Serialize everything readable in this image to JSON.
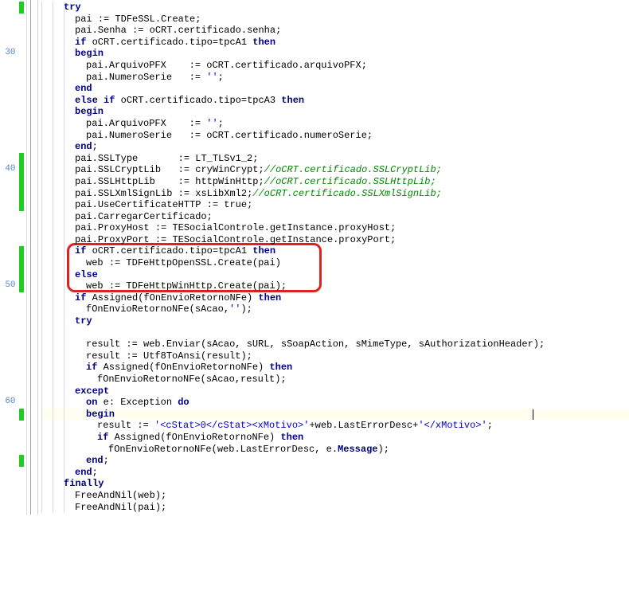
{
  "line_numbers": {
    "30": 4,
    "40": 14,
    "50": 24,
    "60": 34
  },
  "code_lines": [
    {
      "indent": 2,
      "tokens": [
        {
          "t": "kw",
          "v": "try"
        }
      ]
    },
    {
      "indent": 3,
      "tokens": [
        {
          "t": "ident",
          "v": "pai "
        },
        {
          "t": "sym",
          "v": ":= "
        },
        {
          "t": "ident",
          "v": "TDFeSSL"
        },
        {
          "t": "sym",
          "v": "."
        },
        {
          "t": "ident",
          "v": "Create"
        },
        {
          "t": "sym",
          "v": ";"
        }
      ]
    },
    {
      "indent": 3,
      "tokens": [
        {
          "t": "ident",
          "v": "pai"
        },
        {
          "t": "sym",
          "v": "."
        },
        {
          "t": "ident",
          "v": "Senha "
        },
        {
          "t": "sym",
          "v": ":= "
        },
        {
          "t": "ident",
          "v": "oCRT"
        },
        {
          "t": "sym",
          "v": "."
        },
        {
          "t": "ident",
          "v": "certificado"
        },
        {
          "t": "sym",
          "v": "."
        },
        {
          "t": "ident",
          "v": "senha"
        },
        {
          "t": "sym",
          "v": ";"
        }
      ]
    },
    {
      "indent": 3,
      "tokens": [
        {
          "t": "kw",
          "v": "if"
        },
        {
          "t": "ident",
          "v": " oCRT"
        },
        {
          "t": "sym",
          "v": "."
        },
        {
          "t": "ident",
          "v": "certificado"
        },
        {
          "t": "sym",
          "v": "."
        },
        {
          "t": "ident",
          "v": "tipo"
        },
        {
          "t": "sym",
          "v": "="
        },
        {
          "t": "ident",
          "v": "tpcA1 "
        },
        {
          "t": "kw",
          "v": "then"
        }
      ]
    },
    {
      "indent": 3,
      "tokens": [
        {
          "t": "kw",
          "v": "begin"
        }
      ]
    },
    {
      "indent": 4,
      "tokens": [
        {
          "t": "ident",
          "v": "pai"
        },
        {
          "t": "sym",
          "v": "."
        },
        {
          "t": "ident",
          "v": "ArquivoPFX    "
        },
        {
          "t": "sym",
          "v": ":= "
        },
        {
          "t": "ident",
          "v": "oCRT"
        },
        {
          "t": "sym",
          "v": "."
        },
        {
          "t": "ident",
          "v": "certificado"
        },
        {
          "t": "sym",
          "v": "."
        },
        {
          "t": "ident",
          "v": "arquivoPFX"
        },
        {
          "t": "sym",
          "v": ";"
        }
      ]
    },
    {
      "indent": 4,
      "tokens": [
        {
          "t": "ident",
          "v": "pai"
        },
        {
          "t": "sym",
          "v": "."
        },
        {
          "t": "ident",
          "v": "NumeroSerie   "
        },
        {
          "t": "sym",
          "v": ":= "
        },
        {
          "t": "str",
          "v": "''"
        },
        {
          "t": "sym",
          "v": ";"
        }
      ]
    },
    {
      "indent": 3,
      "tokens": [
        {
          "t": "kw",
          "v": "end"
        }
      ]
    },
    {
      "indent": 3,
      "tokens": [
        {
          "t": "kw",
          "v": "else if"
        },
        {
          "t": "ident",
          "v": " oCRT"
        },
        {
          "t": "sym",
          "v": "."
        },
        {
          "t": "ident",
          "v": "certificado"
        },
        {
          "t": "sym",
          "v": "."
        },
        {
          "t": "ident",
          "v": "tipo"
        },
        {
          "t": "sym",
          "v": "="
        },
        {
          "t": "ident",
          "v": "tpcA3 "
        },
        {
          "t": "kw",
          "v": "then"
        }
      ]
    },
    {
      "indent": 3,
      "tokens": [
        {
          "t": "kw",
          "v": "begin"
        }
      ]
    },
    {
      "indent": 4,
      "tokens": [
        {
          "t": "ident",
          "v": "pai"
        },
        {
          "t": "sym",
          "v": "."
        },
        {
          "t": "ident",
          "v": "ArquivoPFX    "
        },
        {
          "t": "sym",
          "v": ":= "
        },
        {
          "t": "str",
          "v": "''"
        },
        {
          "t": "sym",
          "v": ";"
        }
      ]
    },
    {
      "indent": 4,
      "tokens": [
        {
          "t": "ident",
          "v": "pai"
        },
        {
          "t": "sym",
          "v": "."
        },
        {
          "t": "ident",
          "v": "NumeroSerie   "
        },
        {
          "t": "sym",
          "v": ":= "
        },
        {
          "t": "ident",
          "v": "oCRT"
        },
        {
          "t": "sym",
          "v": "."
        },
        {
          "t": "ident",
          "v": "certificado"
        },
        {
          "t": "sym",
          "v": "."
        },
        {
          "t": "ident",
          "v": "numeroSerie"
        },
        {
          "t": "sym",
          "v": ";"
        }
      ]
    },
    {
      "indent": 3,
      "tokens": [
        {
          "t": "kw",
          "v": "end"
        },
        {
          "t": "sym",
          "v": ";"
        }
      ]
    },
    {
      "indent": 3,
      "tokens": [
        {
          "t": "ident",
          "v": "pai"
        },
        {
          "t": "sym",
          "v": "."
        },
        {
          "t": "ident",
          "v": "SSLType       "
        },
        {
          "t": "sym",
          "v": ":= "
        },
        {
          "t": "ident",
          "v": "LT_TLSv1_2"
        },
        {
          "t": "sym",
          "v": ";"
        }
      ]
    },
    {
      "indent": 3,
      "tokens": [
        {
          "t": "ident",
          "v": "pai"
        },
        {
          "t": "sym",
          "v": "."
        },
        {
          "t": "ident",
          "v": "SSLCryptLib   "
        },
        {
          "t": "sym",
          "v": ":= "
        },
        {
          "t": "ident",
          "v": "cryWinCrypt"
        },
        {
          "t": "sym",
          "v": ";"
        },
        {
          "t": "cmt",
          "v": "//oCRT.certificado.SSLCryptLib;"
        }
      ]
    },
    {
      "indent": 3,
      "tokens": [
        {
          "t": "ident",
          "v": "pai"
        },
        {
          "t": "sym",
          "v": "."
        },
        {
          "t": "ident",
          "v": "SSLHttpLib    "
        },
        {
          "t": "sym",
          "v": ":= "
        },
        {
          "t": "ident",
          "v": "httpWinHttp"
        },
        {
          "t": "sym",
          "v": ";"
        },
        {
          "t": "cmt",
          "v": "//oCRT.certificado.SSLHttpLib;"
        }
      ]
    },
    {
      "indent": 3,
      "tokens": [
        {
          "t": "ident",
          "v": "pai"
        },
        {
          "t": "sym",
          "v": "."
        },
        {
          "t": "ident",
          "v": "SSLXmlSignLib "
        },
        {
          "t": "sym",
          "v": ":= "
        },
        {
          "t": "ident",
          "v": "xsLibXml2"
        },
        {
          "t": "sym",
          "v": ";"
        },
        {
          "t": "cmt",
          "v": "//oCRT.certificado.SSLXmlSignLib;"
        }
      ]
    },
    {
      "indent": 3,
      "tokens": [
        {
          "t": "ident",
          "v": "pai"
        },
        {
          "t": "sym",
          "v": "."
        },
        {
          "t": "ident",
          "v": "UseCertificateHTTP "
        },
        {
          "t": "sym",
          "v": ":= "
        },
        {
          "t": "ident",
          "v": "true"
        },
        {
          "t": "sym",
          "v": ";"
        }
      ]
    },
    {
      "indent": 3,
      "tokens": [
        {
          "t": "ident",
          "v": "pai"
        },
        {
          "t": "sym",
          "v": "."
        },
        {
          "t": "ident",
          "v": "CarregarCertificado"
        },
        {
          "t": "sym",
          "v": ";"
        }
      ]
    },
    {
      "indent": 3,
      "tokens": [
        {
          "t": "ident",
          "v": "pai"
        },
        {
          "t": "sym",
          "v": "."
        },
        {
          "t": "ident",
          "v": "ProxyHost "
        },
        {
          "t": "sym",
          "v": ":= "
        },
        {
          "t": "ident",
          "v": "TESocialControle"
        },
        {
          "t": "sym",
          "v": "."
        },
        {
          "t": "ident",
          "v": "getInstance"
        },
        {
          "t": "sym",
          "v": "."
        },
        {
          "t": "ident",
          "v": "proxyHost"
        },
        {
          "t": "sym",
          "v": ";"
        }
      ]
    },
    {
      "indent": 3,
      "tokens": [
        {
          "t": "ident",
          "v": "pai"
        },
        {
          "t": "sym",
          "v": "."
        },
        {
          "t": "ident",
          "v": "ProxyPort "
        },
        {
          "t": "sym",
          "v": ":= "
        },
        {
          "t": "ident",
          "v": "TESocialControle"
        },
        {
          "t": "sym",
          "v": "."
        },
        {
          "t": "ident",
          "v": "getInstance"
        },
        {
          "t": "sym",
          "v": "."
        },
        {
          "t": "ident",
          "v": "proxyPort"
        },
        {
          "t": "sym",
          "v": ";"
        }
      ]
    },
    {
      "indent": 3,
      "tokens": [
        {
          "t": "kw",
          "v": "if"
        },
        {
          "t": "ident",
          "v": " oCRT"
        },
        {
          "t": "sym",
          "v": "."
        },
        {
          "t": "ident",
          "v": "certificado"
        },
        {
          "t": "sym",
          "v": "."
        },
        {
          "t": "ident",
          "v": "tipo"
        },
        {
          "t": "sym",
          "v": "="
        },
        {
          "t": "ident",
          "v": "tpcA1 "
        },
        {
          "t": "kw",
          "v": "then"
        }
      ]
    },
    {
      "indent": 4,
      "tokens": [
        {
          "t": "ident",
          "v": "web "
        },
        {
          "t": "sym",
          "v": ":= "
        },
        {
          "t": "ident",
          "v": "TDFeHttpOpenSSL"
        },
        {
          "t": "sym",
          "v": "."
        },
        {
          "t": "ident",
          "v": "Create"
        },
        {
          "t": "sym",
          "v": "("
        },
        {
          "t": "ident",
          "v": "pai"
        },
        {
          "t": "sym",
          "v": ")"
        }
      ]
    },
    {
      "indent": 3,
      "tokens": [
        {
          "t": "kw",
          "v": "else"
        }
      ]
    },
    {
      "indent": 4,
      "tokens": [
        {
          "t": "ident",
          "v": "web "
        },
        {
          "t": "sym",
          "v": ":= "
        },
        {
          "t": "ident",
          "v": "TDFeHttpWinHttp"
        },
        {
          "t": "sym",
          "v": "."
        },
        {
          "t": "ident",
          "v": "Create"
        },
        {
          "t": "sym",
          "v": "("
        },
        {
          "t": "ident",
          "v": "pai"
        },
        {
          "t": "sym",
          "v": ");"
        }
      ]
    },
    {
      "indent": 3,
      "tokens": [
        {
          "t": "kw",
          "v": "if"
        },
        {
          "t": "ident",
          "v": " Assigned"
        },
        {
          "t": "sym",
          "v": "("
        },
        {
          "t": "ident",
          "v": "fOnEnvioRetornoNFe"
        },
        {
          "t": "sym",
          "v": ") "
        },
        {
          "t": "kw",
          "v": "then"
        }
      ]
    },
    {
      "indent": 4,
      "tokens": [
        {
          "t": "ident",
          "v": "fOnEnvioRetornoNFe"
        },
        {
          "t": "sym",
          "v": "("
        },
        {
          "t": "ident",
          "v": "sAcao"
        },
        {
          "t": "sym",
          "v": ","
        },
        {
          "t": "str",
          "v": "''"
        },
        {
          "t": "sym",
          "v": ");"
        }
      ]
    },
    {
      "indent": 3,
      "tokens": [
        {
          "t": "kw",
          "v": "try"
        }
      ]
    },
    {
      "indent": 3,
      "tokens": []
    },
    {
      "indent": 4,
      "tokens": [
        {
          "t": "ident",
          "v": "result "
        },
        {
          "t": "sym",
          "v": ":= "
        },
        {
          "t": "ident",
          "v": "web"
        },
        {
          "t": "sym",
          "v": "."
        },
        {
          "t": "ident",
          "v": "Enviar"
        },
        {
          "t": "sym",
          "v": "("
        },
        {
          "t": "ident",
          "v": "sAcao"
        },
        {
          "t": "sym",
          "v": ", "
        },
        {
          "t": "ident",
          "v": "sURL"
        },
        {
          "t": "sym",
          "v": ", "
        },
        {
          "t": "ident",
          "v": "sSoapAction"
        },
        {
          "t": "sym",
          "v": ", "
        },
        {
          "t": "ident",
          "v": "sMimeType"
        },
        {
          "t": "sym",
          "v": ", "
        },
        {
          "t": "ident",
          "v": "sAuthorizationHeader"
        },
        {
          "t": "sym",
          "v": ");"
        }
      ]
    },
    {
      "indent": 4,
      "tokens": [
        {
          "t": "ident",
          "v": "result "
        },
        {
          "t": "sym",
          "v": ":= "
        },
        {
          "t": "ident",
          "v": "Utf8ToAnsi"
        },
        {
          "t": "sym",
          "v": "("
        },
        {
          "t": "ident",
          "v": "result"
        },
        {
          "t": "sym",
          "v": ");"
        }
      ]
    },
    {
      "indent": 4,
      "tokens": [
        {
          "t": "kw",
          "v": "if"
        },
        {
          "t": "ident",
          "v": " Assigned"
        },
        {
          "t": "sym",
          "v": "("
        },
        {
          "t": "ident",
          "v": "fOnEnvioRetornoNFe"
        },
        {
          "t": "sym",
          "v": ") "
        },
        {
          "t": "kw",
          "v": "then"
        }
      ]
    },
    {
      "indent": 5,
      "tokens": [
        {
          "t": "ident",
          "v": "fOnEnvioRetornoNFe"
        },
        {
          "t": "sym",
          "v": "("
        },
        {
          "t": "ident",
          "v": "sAcao"
        },
        {
          "t": "sym",
          "v": ","
        },
        {
          "t": "ident",
          "v": "result"
        },
        {
          "t": "sym",
          "v": ");"
        }
      ]
    },
    {
      "indent": 3,
      "tokens": [
        {
          "t": "kw",
          "v": "except"
        }
      ]
    },
    {
      "indent": 4,
      "tokens": [
        {
          "t": "kw",
          "v": "on"
        },
        {
          "t": "ident",
          "v": " e"
        },
        {
          "t": "sym",
          "v": ": "
        },
        {
          "t": "ident",
          "v": "Exception "
        },
        {
          "t": "kw",
          "v": "do"
        }
      ]
    },
    {
      "indent": 4,
      "tokens": [
        {
          "t": "kw",
          "v": "begin"
        }
      ],
      "highlight": true,
      "caret_after": true
    },
    {
      "indent": 5,
      "tokens": [
        {
          "t": "ident",
          "v": "result "
        },
        {
          "t": "sym",
          "v": ":= "
        },
        {
          "t": "str",
          "v": "'<cStat>0</cStat><xMotivo>'"
        },
        {
          "t": "sym",
          "v": "+"
        },
        {
          "t": "ident",
          "v": "web"
        },
        {
          "t": "sym",
          "v": "."
        },
        {
          "t": "ident",
          "v": "LastErrorDesc"
        },
        {
          "t": "sym",
          "v": "+"
        },
        {
          "t": "str",
          "v": "'</xMotivo>'"
        },
        {
          "t": "sym",
          "v": ";"
        }
      ]
    },
    {
      "indent": 5,
      "tokens": [
        {
          "t": "kw",
          "v": "if"
        },
        {
          "t": "ident",
          "v": " Assigned"
        },
        {
          "t": "sym",
          "v": "("
        },
        {
          "t": "ident",
          "v": "fOnEnvioRetornoNFe"
        },
        {
          "t": "sym",
          "v": ") "
        },
        {
          "t": "kw",
          "v": "then"
        }
      ]
    },
    {
      "indent": 6,
      "tokens": [
        {
          "t": "ident",
          "v": "fOnEnvioRetornoNFe"
        },
        {
          "t": "sym",
          "v": "("
        },
        {
          "t": "ident",
          "v": "web"
        },
        {
          "t": "sym",
          "v": "."
        },
        {
          "t": "ident",
          "v": "LastErrorDesc"
        },
        {
          "t": "sym",
          "v": ", "
        },
        {
          "t": "ident",
          "v": "e"
        },
        {
          "t": "sym",
          "v": "."
        },
        {
          "t": "kw",
          "v": "Message"
        },
        {
          "t": "sym",
          "v": ");"
        }
      ]
    },
    {
      "indent": 4,
      "tokens": [
        {
          "t": "kw",
          "v": "end"
        },
        {
          "t": "sym",
          "v": ";"
        }
      ]
    },
    {
      "indent": 3,
      "tokens": [
        {
          "t": "kw",
          "v": "end"
        },
        {
          "t": "sym",
          "v": ";"
        }
      ]
    },
    {
      "indent": 2,
      "tokens": [
        {
          "t": "kw",
          "v": "finally"
        }
      ]
    },
    {
      "indent": 3,
      "tokens": [
        {
          "t": "ident",
          "v": "FreeAndNil"
        },
        {
          "t": "sym",
          "v": "("
        },
        {
          "t": "ident",
          "v": "web"
        },
        {
          "t": "sym",
          "v": ");"
        }
      ]
    },
    {
      "indent": 3,
      "tokens": [
        {
          "t": "ident",
          "v": "FreeAndNil"
        },
        {
          "t": "sym",
          "v": "("
        },
        {
          "t": "ident",
          "v": "pai"
        },
        {
          "t": "sym",
          "v": ");"
        }
      ]
    }
  ],
  "change_markers": [
    {
      "start": 0,
      "height": 1
    },
    {
      "start": 13,
      "height": 5
    },
    {
      "start": 21,
      "height": 4
    },
    {
      "start": 35,
      "height": 1
    },
    {
      "start": 39,
      "height": 1
    }
  ],
  "redbox": {
    "top_line": 21,
    "height_lines": 4
  },
  "colors": {
    "keyword": "#000088",
    "string": "#0000cc",
    "comment": "#008800",
    "marker": "#22cc22",
    "redbox": "#dd2222",
    "highlight": "#fffff0",
    "linenum": "#5588cc"
  }
}
